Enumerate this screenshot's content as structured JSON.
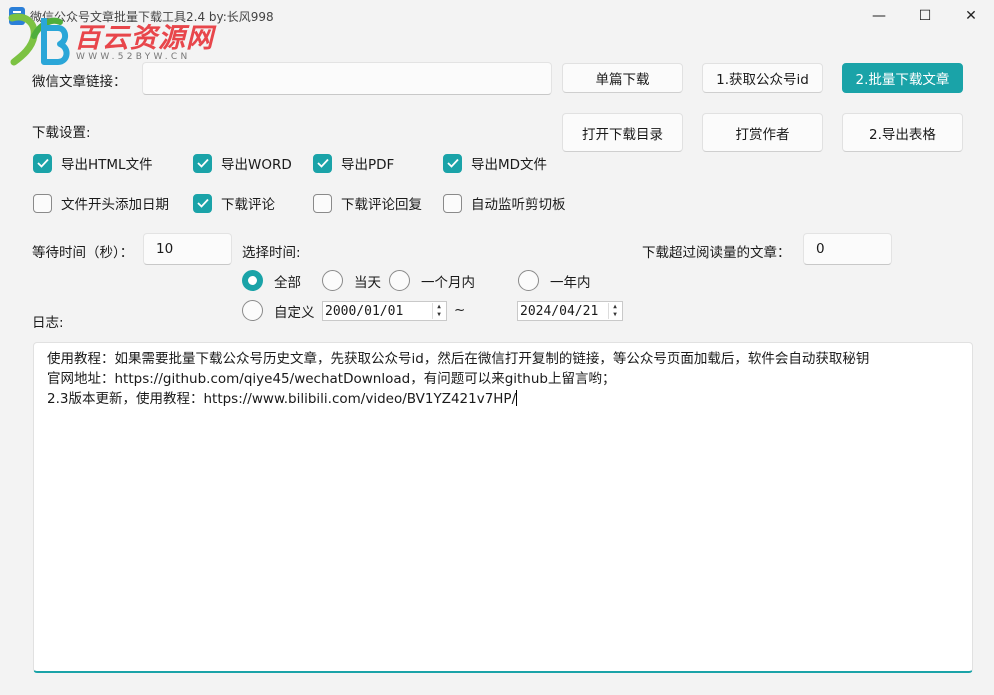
{
  "window": {
    "title": "微信公众号文章批量下载工具2.4 by:长风998",
    "min_glyph": "—",
    "max_glyph": "☐",
    "close_glyph": "✕"
  },
  "watermark": {
    "text": "百云资源网",
    "url": "WWW.52BYW.CN",
    "color": "#e8464b"
  },
  "link": {
    "label": "微信文章链接：",
    "value": ""
  },
  "buttons": {
    "single_download": "单篇下载",
    "get_id": "1.获取公众号id",
    "batch_download": "2.批量下载文章",
    "open_dir": "打开下载目录",
    "tip_author": "打赏作者",
    "export_table": "2.导出表格"
  },
  "settings": {
    "label": "下载设置:",
    "checkboxes": [
      {
        "label": "导出HTML文件",
        "checked": true
      },
      {
        "label": "导出WORD",
        "checked": true
      },
      {
        "label": "导出PDF",
        "checked": true
      },
      {
        "label": "导出MD文件",
        "checked": true
      },
      {
        "label": "文件开头添加日期",
        "checked": false
      },
      {
        "label": "下载评论",
        "checked": true
      },
      {
        "label": "下载评论回复",
        "checked": false
      },
      {
        "label": "自动监听剪切板",
        "checked": false
      }
    ]
  },
  "wait": {
    "label": "等待时间（秒）：",
    "value": "10"
  },
  "time_select": {
    "label": "选择时间:",
    "options": [
      {
        "label": "全部",
        "selected": true
      },
      {
        "label": "当天",
        "selected": false
      },
      {
        "label": "一个月内",
        "selected": false
      },
      {
        "label": "一年内",
        "selected": false
      },
      {
        "label": "自定义",
        "selected": false
      }
    ],
    "start_date": "2000/01/01",
    "separator": "~",
    "end_date": "2024/04/21"
  },
  "read_count": {
    "label": "下载超过阅读量的文章：",
    "value": "0"
  },
  "log": {
    "label": "日志:",
    "lines": [
      "使用教程：如果需要批量下载公众号历史文章，先获取公众号id，然后在微信打开复制的链接，等公众号页面加载后，软件会自动获取秘钥",
      "官网地址：https://github.com/qiye45/wechatDownload，有问题可以来github上留言哟；",
      "2.3版本更新，使用教程：https://www.bilibili.com/video/BV1YZ421v7HP/"
    ]
  },
  "colors": {
    "accent": "#1aa3a8",
    "window_bg": "#f3f3f3"
  }
}
